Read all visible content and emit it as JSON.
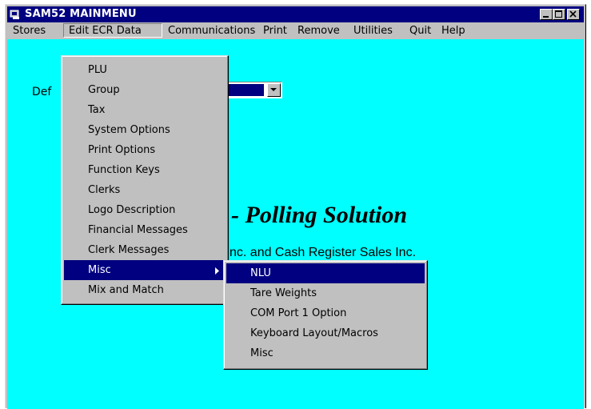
{
  "window": {
    "title": "SAM52 MAINMENU"
  },
  "titlebar_buttons": {
    "minimize": "minimize-icon",
    "maximize": "maximize-icon",
    "close": "close-icon"
  },
  "menubar": [
    "Stores",
    "Edit ECR Data",
    "Communications",
    "Print",
    "Remove",
    "Utilities",
    "Quit",
    "Help"
  ],
  "edit_menu": [
    "PLU",
    "Group",
    "Tax",
    "System Options",
    "Print Options",
    "Function Keys",
    "Clerks",
    "Logo Description",
    "Financial Messages",
    "Clerk Messages",
    "Misc",
    "Mix and Match"
  ],
  "misc_submenu": [
    "NLU",
    "Tare Weights",
    "COM Port 1 Option",
    "Keyboard Layout/Macros",
    "Misc"
  ],
  "client": {
    "default_label": "Def",
    "headline": "- Polling Solution",
    "credit": "nc. and Cash Register Sales Inc."
  },
  "colors": {
    "titlebar": "#000080",
    "client_bg": "#00ffff",
    "highlight": "#000080",
    "face": "#c0c0c0"
  }
}
